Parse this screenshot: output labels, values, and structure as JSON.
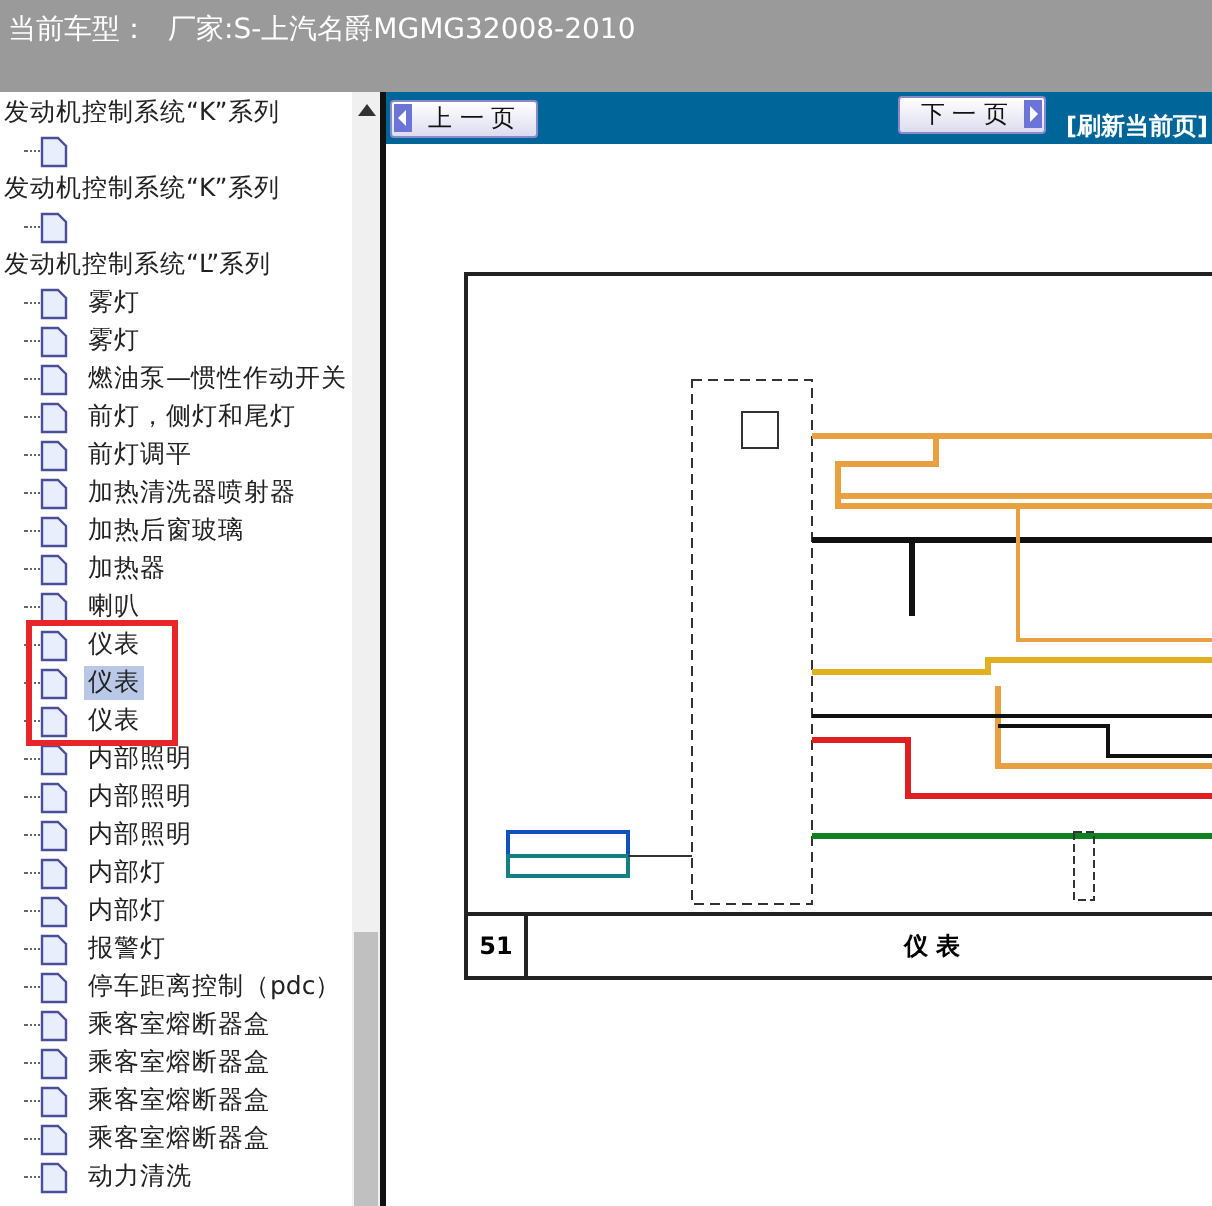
{
  "header": {
    "label": "当前车型：",
    "value": "厂家:S-上汽名爵MGMG32008-2010"
  },
  "tree": [
    {
      "label": "发动机控制系统“K”系列",
      "children": [
        {
          "selected": false
        }
      ]
    },
    {
      "label": "发动机控制系统“K”系列",
      "children": [
        {
          "selected": false
        }
      ]
    },
    {
      "label": "发动机控制系统“L”系列",
      "children": [
        {
          "label": "雾灯",
          "selected": false
        },
        {
          "label": "雾灯",
          "selected": false
        },
        {
          "label": "燃油泵—惯性作动开关",
          "selected": false
        },
        {
          "label": "前灯，侧灯和尾灯",
          "selected": false
        },
        {
          "label": "前灯调平",
          "selected": false
        },
        {
          "label": "加热清洗器喷射器",
          "selected": false
        },
        {
          "label": "加热后窗玻璃",
          "selected": false
        },
        {
          "label": "加热器",
          "selected": false
        },
        {
          "label": "喇叭",
          "selected": false
        },
        {
          "label": "仪表",
          "selected": false
        },
        {
          "label": "仪表",
          "selected": true
        },
        {
          "label": "仪表",
          "selected": false
        },
        {
          "label": "内部照明",
          "selected": false
        },
        {
          "label": "内部照明",
          "selected": false
        },
        {
          "label": "内部照明",
          "selected": false
        },
        {
          "label": "内部灯",
          "selected": false
        },
        {
          "label": "内部灯",
          "selected": false
        },
        {
          "label": "报警灯",
          "selected": false
        },
        {
          "label": "停车距离控制（pdc）",
          "selected": false
        },
        {
          "label": "乘客室熔断器盒",
          "selected": false
        },
        {
          "label": "乘客室熔断器盒",
          "selected": false
        },
        {
          "label": "乘客室熔断器盒",
          "selected": false
        },
        {
          "label": "乘客室熔断器盒",
          "selected": false
        },
        {
          "label": "动力清洗",
          "selected": false
        }
      ]
    }
  ],
  "toolbar": {
    "prev": "上 一 页",
    "next": "下 一 页",
    "refresh": "[刷新当前页]"
  },
  "diagram": {
    "page_number": "51",
    "title": "仪 表"
  }
}
